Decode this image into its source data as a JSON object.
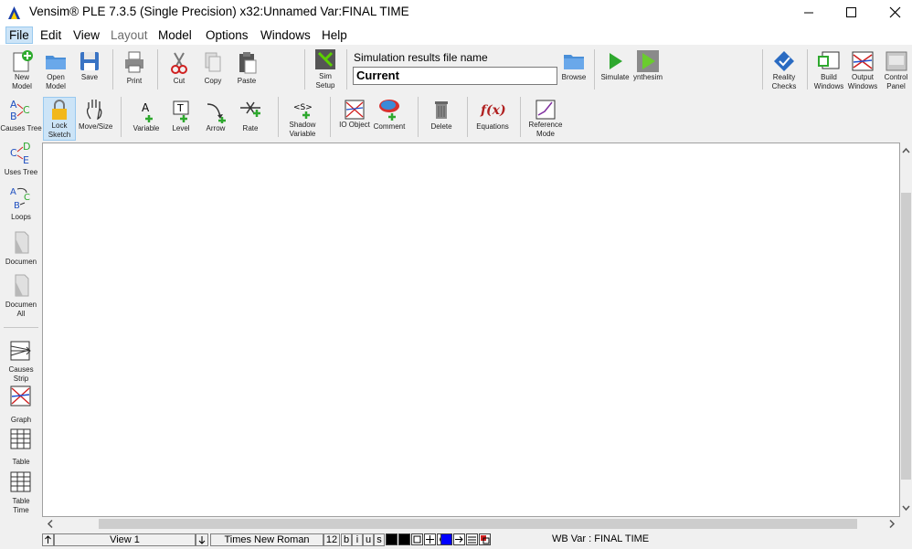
{
  "window": {
    "title": "Vensim® PLE 7.3.5 (Single Precision) x32:Unnamed Var:FINAL TIME",
    "minimize_icon": "minimize-icon",
    "maximize_icon": "maximize-icon",
    "close_icon": "close-icon"
  },
  "menu": [
    "File",
    "Edit",
    "View",
    "Layout",
    "Model",
    "Options",
    "Windows",
    "Help"
  ],
  "toolbar1": {
    "new_model": "New Model",
    "open_model": "Open Model",
    "save": "Save",
    "print": "Print",
    "cut": "Cut",
    "copy": "Copy",
    "paste": "Paste",
    "sim_setup": "Sim Setup",
    "sim_label": "Simulation results file name",
    "sim_value": "Current",
    "browse": "Browse",
    "simulate": "Simulate",
    "synthesim": "ynthesim",
    "reality_checks": "Reality Checks",
    "build_windows": "Build Windows",
    "output_windows": "Output Windows",
    "control_panel": "Control Panel"
  },
  "toolbar2": {
    "lock_sketch": "Lock Sketch",
    "move_size": "Move/Size",
    "variable": "Variable",
    "level": "Level",
    "arrow": "Arrow",
    "rate": "Rate",
    "shadow_variable": "Shadow Variable",
    "io_object": "IO Object",
    "comment": "Comment",
    "delete": "Delete",
    "equations": "Equations",
    "reference_mode": "Reference Mode"
  },
  "leftbar": {
    "causes_tree": "Causes Tree",
    "uses_tree": "Uses Tree",
    "loops": "Loops",
    "document": "Documen",
    "document_all": "Documen All",
    "causes_strip": "Causes Strip",
    "graph": "Graph",
    "table": "Table",
    "table_time": "Table Time"
  },
  "statusbar": {
    "view": "View 1",
    "font": "Times New Roman",
    "size": "12",
    "bold": "b",
    "italic": "i",
    "underline": "u",
    "strike": "s",
    "workbench": "WB Var : FINAL TIME"
  },
  "colors": {
    "accent": "#cce4f7",
    "canvas": "#ffffff",
    "selected_tool": "#cce4f7"
  }
}
